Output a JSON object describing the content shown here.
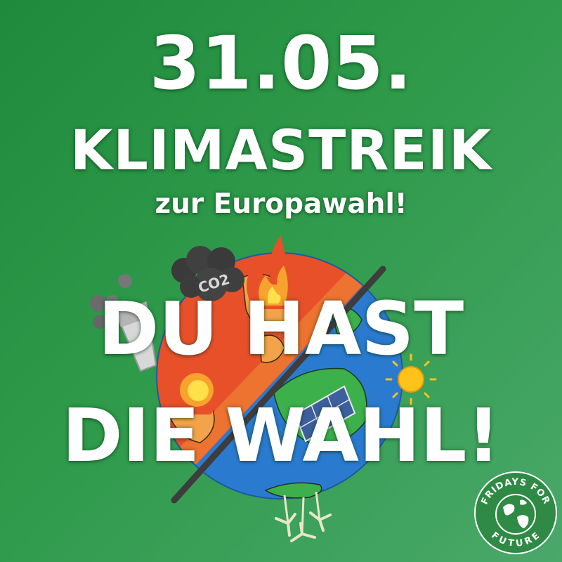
{
  "date": "31.05.",
  "title": "KLIMASTREIK",
  "subtitle": "zur Europawahl!",
  "slogan": {
    "line1": "DU HAST",
    "line2": "DIE WAHL!"
  },
  "co2_label": "CO2",
  "logo": {
    "top_text": "FRIDAYS FOR",
    "bottom_text": "FUTURE"
  },
  "colors": {
    "background": "#2e9a4a",
    "text": "#ffffff",
    "fire": "#e8502a",
    "ocean": "#2a7bd0",
    "logo_bg": "#2e8a44"
  }
}
